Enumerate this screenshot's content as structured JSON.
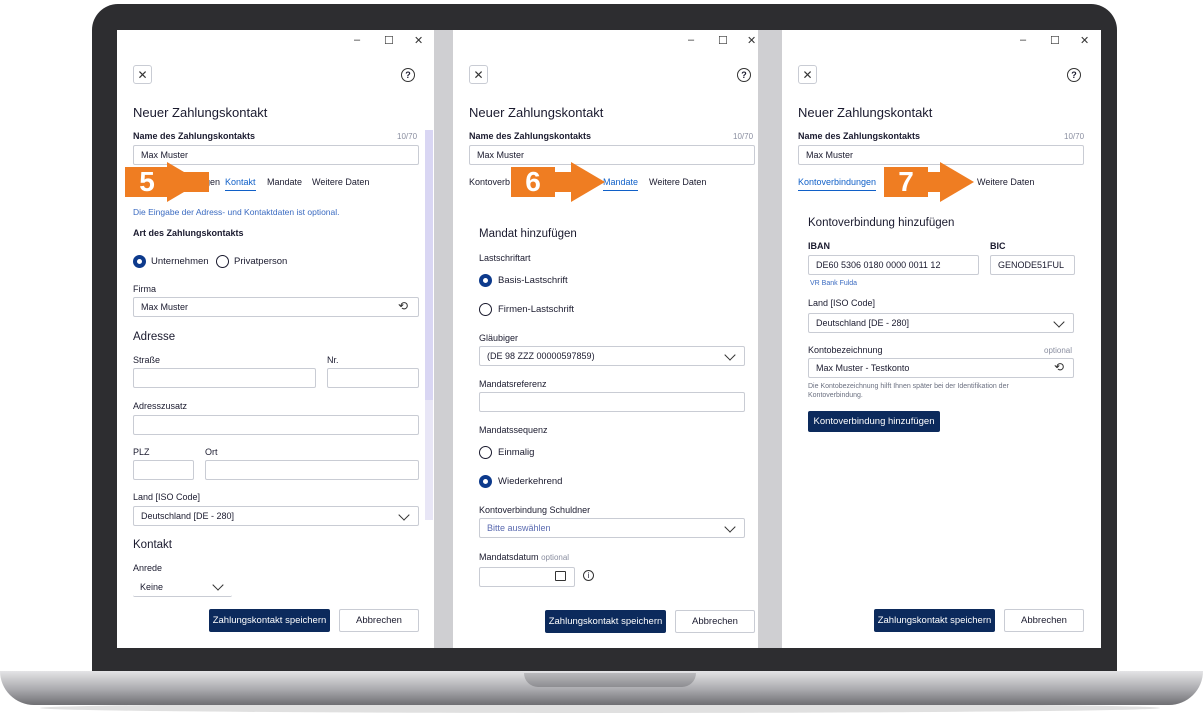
{
  "common": {
    "title": "Neuer Zahlungskontakt",
    "name_label": "Name des Zahlungskontakts",
    "name_count": "10/70",
    "name_value": "Max Muster",
    "save_button": "Zahlungskontakt speichern",
    "cancel_button": "Abbrechen",
    "win_min": "–",
    "win_max": "☐",
    "win_close": "✕",
    "close_icon": "✕",
    "help_icon": "?"
  },
  "panel1": {
    "badge": "5",
    "tabs": [
      "gen",
      "Kontakt",
      "Mandate",
      "Weitere Daten"
    ],
    "active_tab": "Kontakt",
    "info": "Die Eingabe der Adress- und Kontaktdaten ist optional.",
    "type_label": "Art des Zahlungskontakts",
    "radio_company": "Unternehmen",
    "radio_private": "Privatperson",
    "firma_label": "Firma",
    "firma_value": "Max Muster",
    "address_title": "Adresse",
    "street_label": "Straße",
    "nr_label": "Nr.",
    "addr_extra_label": "Adresszusatz",
    "plz_label": "PLZ",
    "ort_label": "Ort",
    "country_label": "Land [ISO Code]",
    "country_value": "Deutschland [DE - 280]",
    "contact_title": "Kontakt",
    "salutation_label": "Anrede",
    "salutation_value": "Keine"
  },
  "panel2": {
    "badge": "6",
    "tabs": [
      "Kontoverb",
      "Mandate",
      "Weitere Daten"
    ],
    "active_tab": "Mandate",
    "section": "Mandat hinzufügen",
    "debit_type_label": "Lastschriftart",
    "radio_basis": "Basis-Lastschrift",
    "radio_firmen": "Firmen-Lastschrift",
    "creditor_label": "Gläubiger",
    "creditor_value": "(DE 98 ZZZ 00000597859)",
    "reference_label": "Mandatsreferenz",
    "sequence_label": "Mandatssequenz",
    "radio_once": "Einmalig",
    "radio_recurring": "Wiederkehrend",
    "debtor_account_label": "Kontoverbindung Schuldner",
    "debtor_account_placeholder": "Bitte auswählen",
    "date_label": "Mandatsdatum",
    "date_optional": "optional"
  },
  "panel3": {
    "badge": "7",
    "tabs": [
      "Kontoverbindungen",
      "Weitere Daten"
    ],
    "active_tab": "Kontoverbindungen",
    "section": "Kontoverbindung hinzufügen",
    "iban_label": "IBAN",
    "iban_value": "DE60 5306 0180 0000 0011 12",
    "bank_name": "VR Bank Fulda",
    "bic_label": "BIC",
    "bic_value": "GENODE51FUL",
    "country_label": "Land [ISO Code]",
    "country_value": "Deutschland [DE - 280]",
    "account_desc_label": "Kontobezeichnung",
    "account_desc_optional": "optional",
    "account_desc_value": "Max Muster - Testkonto",
    "account_desc_hint": "Die Kontobezeichnung hilft Ihnen später bei der Identifikation der Kontoverbindung.",
    "add_button": "Kontoverbindung hinzufügen"
  },
  "colors": {
    "accent": "#1060c8",
    "primary_button": "#0c2a5c",
    "badge": "#ef7d22",
    "radio_selected": "#0d3a8c"
  }
}
